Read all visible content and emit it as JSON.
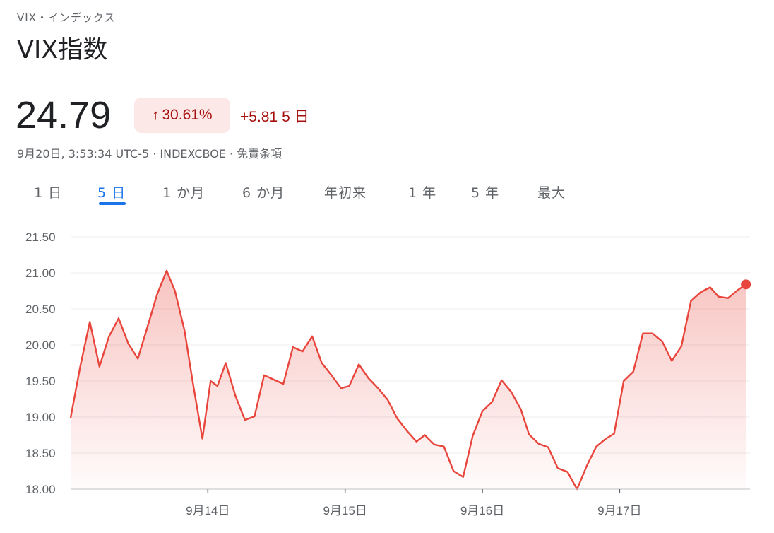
{
  "header": {
    "breadcrumb": "VIX・インデックス",
    "title": "VIX指数"
  },
  "quote": {
    "price": "24.79",
    "change_percent": "30.61%",
    "change_abs": "+5.81",
    "change_period": "5 日",
    "meta": "9月20日, 3:53:34 UTC-5 · INDEXCBOE · 免責条項"
  },
  "tabs": [
    {
      "label": "1 日"
    },
    {
      "label": "5 日"
    },
    {
      "label": "1 か月"
    },
    {
      "label": "6 か月"
    },
    {
      "label": "年初来"
    },
    {
      "label": "1 年"
    },
    {
      "label": "5 年"
    },
    {
      "label": "最大"
    }
  ],
  "colors": {
    "line": "#e8453c",
    "negative_text": "#a50e0e",
    "negative_bg": "#fce8e6",
    "accent": "#1a73e8"
  },
  "chart_data": {
    "type": "area",
    "y_ticks": [
      "21.50",
      "21.00",
      "20.50",
      "20.00",
      "19.50",
      "19.00",
      "18.50",
      "18.00"
    ],
    "ylim": [
      18.0,
      21.5
    ],
    "x_ticks": [
      "9月14日",
      "9月15日",
      "9月16日",
      "9月17日"
    ],
    "xlim": [
      -1.0,
      3.95
    ],
    "grid": true,
    "series": [
      {
        "x": [
          -1.0,
          -0.93,
          -0.86,
          -0.79,
          -0.72,
          -0.65,
          -0.58,
          -0.51,
          -0.44,
          -0.37,
          -0.3,
          -0.24,
          -0.17,
          -0.11,
          -0.04,
          0.02,
          0.07,
          0.13,
          0.2,
          0.27,
          0.34,
          0.41,
          0.48,
          0.55,
          0.62,
          0.69,
          0.76,
          0.83,
          0.9,
          0.97,
          1.03,
          1.1,
          1.17,
          1.24,
          1.31,
          1.38,
          1.45,
          1.52,
          1.58,
          1.65,
          1.72,
          1.79,
          1.86,
          1.93,
          2.0,
          2.07,
          2.14,
          2.21,
          2.28,
          2.34,
          2.41,
          2.48,
          2.55,
          2.62,
          2.69,
          2.76,
          2.83,
          2.9,
          2.96,
          3.03,
          3.1,
          3.17,
          3.24,
          3.31,
          3.38,
          3.45,
          3.52,
          3.59,
          3.66,
          3.72,
          3.79,
          3.86,
          3.92
        ],
        "y": [
          18.99,
          19.7,
          20.32,
          19.7,
          20.12,
          20.37,
          20.02,
          19.81,
          20.25,
          20.7,
          21.03,
          20.75,
          20.2,
          19.48,
          18.7,
          19.5,
          19.43,
          19.75,
          19.3,
          18.96,
          19.01,
          19.58,
          19.52,
          19.46,
          19.97,
          19.91,
          20.12,
          19.75,
          19.58,
          19.4,
          19.43,
          19.73,
          19.54,
          19.4,
          19.24,
          18.98,
          18.81,
          18.66,
          18.75,
          18.62,
          18.59,
          18.25,
          18.17,
          18.74,
          19.08,
          19.21,
          19.51,
          19.35,
          19.11,
          18.76,
          18.63,
          18.58,
          18.29,
          18.24,
          18.0,
          18.32,
          18.59,
          18.7,
          18.77,
          19.5,
          19.63,
          20.16,
          20.16,
          20.05,
          19.78,
          19.98,
          20.61,
          20.73,
          20.8,
          20.67,
          20.65,
          20.76,
          20.84
        ]
      }
    ]
  }
}
